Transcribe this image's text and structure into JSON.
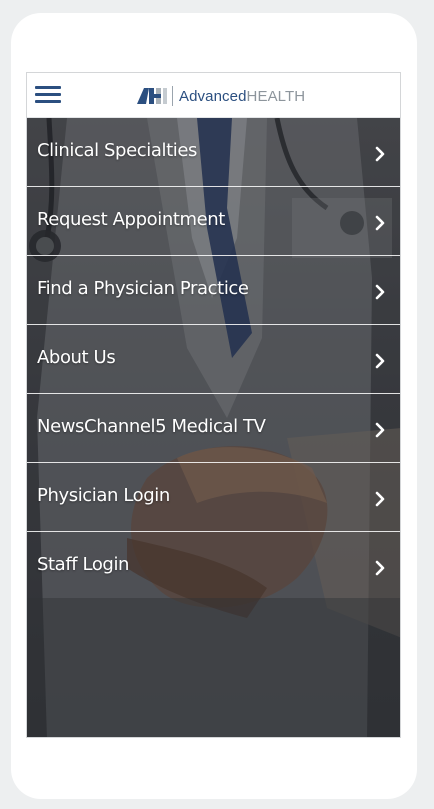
{
  "header": {
    "menu_icon": "hamburger-menu-icon",
    "logo": {
      "mark_icon": "advanced-health-logo-mark",
      "text_part1": "Advanced",
      "text_part2": "HEALTH",
      "primary_color": "#2b4f80",
      "secondary_color": "#8d959c"
    }
  },
  "menu": {
    "chevron_icon": "chevron-right-icon",
    "items": [
      {
        "label": "Clinical Specialties"
      },
      {
        "label": "Request Appointment"
      },
      {
        "label": "Find a Physician Practice"
      },
      {
        "label": "About Us"
      },
      {
        "label": "NewsChannel5 Medical TV"
      },
      {
        "label": "Physician Login"
      },
      {
        "label": "Staff Login"
      }
    ]
  },
  "background": {
    "description_icon": "doctor-handshake-photo"
  }
}
